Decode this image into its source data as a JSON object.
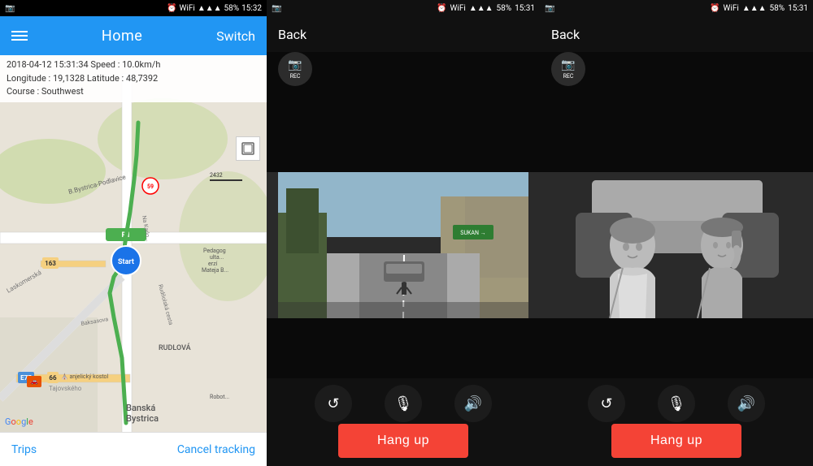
{
  "panel_map": {
    "status_bar": {
      "camera_icon": "📷",
      "alarm_icon": "⏰",
      "wifi_icon": "📶",
      "signal_icon": "📶",
      "battery": "58%",
      "time": "15:32"
    },
    "header": {
      "title": "Home",
      "switch_label": "Switch"
    },
    "info": {
      "line1": "2018-04-12  15:31:34   Speed : 10.0km/h",
      "line2": "Longitude : 19,1328   Latitude : 48,7392",
      "line3": "Course : Southwest"
    },
    "speed_limit": "59",
    "bottom": {
      "trips_label": "Trips",
      "cancel_label": "Cancel tracking"
    },
    "google_logo": "Google"
  },
  "panel_video1": {
    "status_bar": {
      "camera_icon": "📷",
      "time": "15:31"
    },
    "back_label": "Back",
    "rec_label": "REC",
    "controls": {
      "rotate_label": "↺",
      "mic_label": "🎤",
      "speaker_label": "🔊"
    },
    "hangup_label": "Hang up"
  },
  "panel_video2": {
    "status_bar": {
      "camera_icon": "📷",
      "time": "15:31"
    },
    "back_label": "Back",
    "rec_label": "REC",
    "controls": {
      "rotate_label": "↺",
      "mic_label": "🎤",
      "speaker_label": "🔊"
    },
    "hangup_label": "Hang up"
  }
}
